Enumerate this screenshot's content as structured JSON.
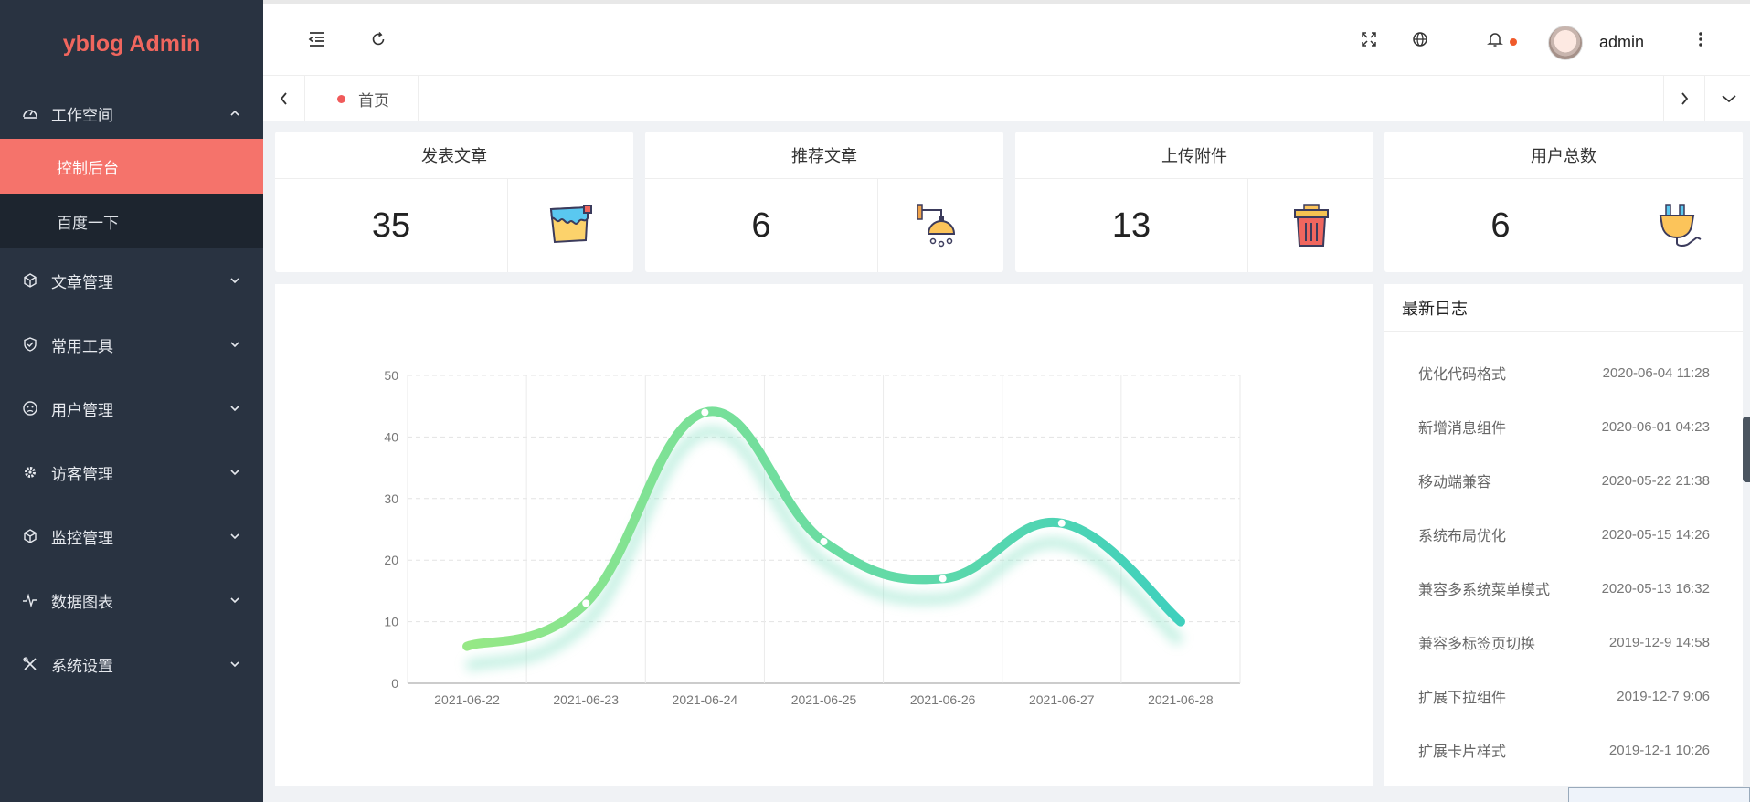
{
  "app": {
    "title": "yblog Admin"
  },
  "sidebar": {
    "workspace": {
      "label": "工作空间",
      "items": [
        {
          "label": "控制后台",
          "active": true
        },
        {
          "label": "百度一下",
          "active": false
        }
      ]
    },
    "menus": [
      {
        "label": "文章管理",
        "icon": "cube-icon"
      },
      {
        "label": "常用工具",
        "icon": "shield-icon"
      },
      {
        "label": "用户管理",
        "icon": "face-icon"
      },
      {
        "label": "访客管理",
        "icon": "gear-icon"
      },
      {
        "label": "监控管理",
        "icon": "cube-icon"
      },
      {
        "label": "数据图表",
        "icon": "pulse-icon"
      },
      {
        "label": "系统设置",
        "icon": "tools-icon"
      }
    ]
  },
  "header": {
    "username": "admin",
    "accent": "#f05a2b"
  },
  "tabs": {
    "home": "首页"
  },
  "stats": [
    {
      "title": "发表文章",
      "value": "35",
      "icon": "paint-bucket-icon"
    },
    {
      "title": "推荐文章",
      "value": "6",
      "icon": "shower-icon"
    },
    {
      "title": "上传附件",
      "value": "13",
      "icon": "trash-bin-icon"
    },
    {
      "title": "用户总数",
      "value": "6",
      "icon": "plug-icon"
    }
  ],
  "chart_data": {
    "type": "line",
    "categories": [
      "2021-06-22",
      "2021-06-23",
      "2021-06-24",
      "2021-06-25",
      "2021-06-26",
      "2021-06-27",
      "2021-06-28"
    ],
    "series": [
      {
        "values": [
          6,
          13,
          44,
          23,
          17,
          26,
          10
        ]
      }
    ],
    "yticks": [
      "0",
      "10",
      "20",
      "30",
      "40",
      "50"
    ],
    "ylim": [
      0,
      50
    ],
    "grid": true,
    "smooth": true,
    "colors": [
      "#96e886",
      "#3fd0bd"
    ]
  },
  "log": {
    "title": "最新日志",
    "items": [
      {
        "name": "优化代码格式",
        "time": "2020-06-04 11:28"
      },
      {
        "name": "新增消息组件",
        "time": "2020-06-01 04:23"
      },
      {
        "name": "移动端兼容",
        "time": "2020-05-22 21:38"
      },
      {
        "name": "系统布局优化",
        "time": "2020-05-15 14:26"
      },
      {
        "name": "兼容多系统菜单模式",
        "time": "2020-05-13 16:32"
      },
      {
        "name": "兼容多标签页切换",
        "time": "2019-12-9 14:58"
      },
      {
        "name": "扩展下拉组件",
        "time": "2019-12-7 9:06"
      },
      {
        "name": "扩展卡片样式",
        "time": "2019-12-1 10:26"
      }
    ]
  }
}
